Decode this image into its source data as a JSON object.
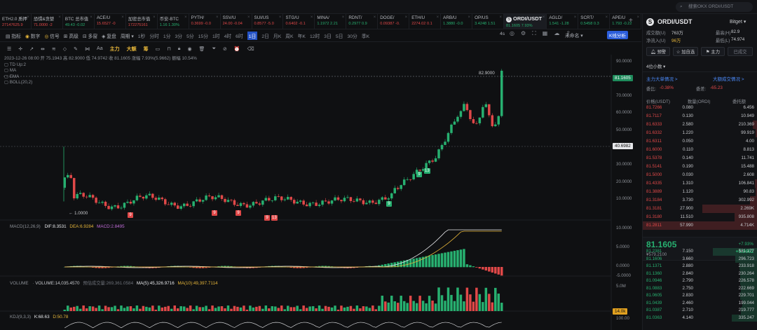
{
  "search": {
    "placeholder": "搜索OKX ORDI/USDT"
  },
  "tickers": [
    {
      "name": "ETH2.0 质押",
      "price": "27147625.9",
      "dir": "dn"
    },
    {
      "name": "恐惧&贪婪",
      "price": "71.0000 -2",
      "dir": "dn"
    },
    {
      "name": "BTC 总市值",
      "price": "49.43 -0.02",
      "dir": "up"
    },
    {
      "name": "ACE/U",
      "price": "15.6527 -0",
      "dir": "dn"
    },
    {
      "name": "加密总市值",
      "price": "172275161",
      "dir": "dn"
    },
    {
      "name": "币安-BTC",
      "price": "1.16 1.30%",
      "dir": "up"
    },
    {
      "name": "PYTH/",
      "price": "0.3699 -0.0",
      "dir": "dn"
    },
    {
      "name": "SSV/U",
      "price": "24.00 -0.04",
      "dir": "dn"
    },
    {
      "name": "SUI/US",
      "price": "0.8577 -5.0",
      "dir": "dn"
    },
    {
      "name": "STG/U",
      "price": "0.6402 -0.1",
      "dir": "dn"
    },
    {
      "name": "MINA/",
      "price": "1.1972 2.21",
      "dir": "up"
    },
    {
      "name": "RDNT/",
      "price": "0.2977 0.9",
      "dir": "up"
    },
    {
      "name": "DOGE/",
      "price": "0.09387 -0.",
      "dir": "dn"
    },
    {
      "name": "ETH/U",
      "price": "2274.02 0.1",
      "dir": "dn"
    },
    {
      "name": "ARB/U",
      "price": "1.3880 -0.0",
      "dir": "up"
    },
    {
      "name": "OP/US",
      "price": "3.4248 1.51",
      "dir": "up"
    },
    {
      "name": "ORDI/USDT",
      "price": "81.1605 7.93%",
      "dir": "up",
      "active": true
    },
    {
      "name": "AGLD/",
      "price": "1.541 -1.28",
      "dir": "up"
    },
    {
      "name": "SCRT/",
      "price": "0.5458 0.3",
      "dir": "up"
    },
    {
      "name": "APE/U",
      "price": "1.793 -0.22",
      "dir": "up"
    }
  ],
  "toolbar1": {
    "items": [
      "指标",
      "数字",
      "信号",
      "高级",
      "多窗",
      "复盘",
      "周期"
    ],
    "timeframes": [
      "1秒",
      "分时",
      "1分",
      "3分",
      "5分",
      "15分",
      "1时",
      "4时",
      "6时",
      "1日",
      "2日",
      "月K",
      "周K",
      "年K",
      "12时",
      "3日",
      "5日",
      "30分",
      "季K"
    ],
    "selected_tf": "1日",
    "right_time": "4s",
    "layout_name": "未命名",
    "kline_btn": "K线分析"
  },
  "toolbar2": {
    "labels": [
      "主力",
      "大额",
      "筹"
    ]
  },
  "chart": {
    "info": "2023-12-26 08:00  开 75.1943  高 82.9000  低 74.9742  收 81.1605  涨幅 7.93%(5.9662)  振幅 10.54%",
    "indicators": [
      "TD  Up:2",
      "MA",
      "EMA",
      "BOLL(20,2)"
    ],
    "high_label": "82.9000",
    "low_label": "1.0000",
    "current_price": "81.1605",
    "cross_price": "40.6982",
    "price_ticks": [
      "90.0000",
      "70.0000",
      "60.0000",
      "50.0000",
      "30.0000",
      "20.0000",
      "10.0000"
    ],
    "macd_label": "MACD(12,26,9)",
    "macd_dif": "DIF:8.3531",
    "macd_dea": "DEA:6.9284",
    "macd_val": "MACD:2.8495",
    "macd_ticks": [
      "10.0000",
      "5.0000",
      "0.0000",
      "-5.0000"
    ],
    "vol_label": "VOLUME",
    "vol_val": "VOLUME:14,035.4570",
    "vol_est": "预估成交量:269,361.0584",
    "vol_ma5": "MA(5):45,326.9716",
    "vol_ma10": "MA(10):49,397.7114",
    "vol_ticks": [
      "5.0M"
    ],
    "vol_tag": "14.0k",
    "kdj_label": "KDJ(9,3,3)",
    "kdj_k": "K:68.63",
    "kdj_d": "D:50.78",
    "kdj_tick": "100.00",
    "td_marks": [
      "9",
      "9",
      "9",
      "9",
      "13",
      "9",
      "9",
      "13"
    ]
  },
  "right_panel": {
    "symbol": "ORDI/USDT",
    "exchange": "Bitget",
    "vol_label": "成交额(U)",
    "vol_value": "763万",
    "high_label": "最高(H)",
    "high_value": "82.9",
    "inflow_label": "净流入(U)",
    "inflow_value": "96万",
    "low_label": "最低(L)",
    "low_value": "74.974",
    "buttons": [
      "预警",
      "加自选",
      "主力",
      "已成交"
    ],
    "decimals": "4位小数",
    "big_order": "主力大单情况 >",
    "big_trade": "大额成交情况 >",
    "ratio_label": "委比:",
    "ratio_value": "-0.38%",
    "diff_label": "委差:",
    "diff_value": "-65.23",
    "headers": [
      "价格(USDT)",
      "数量(ORDI)",
      "委托额"
    ],
    "asks": [
      [
        "81.7266",
        "0.080",
        "6.456"
      ],
      [
        "81.7117",
        "0.130",
        "10.949"
      ],
      [
        "81.6333",
        "2.580",
        "210.369"
      ],
      [
        "81.6332",
        "1.220",
        "99.919"
      ],
      [
        "81.6311",
        "0.050",
        "4.00"
      ],
      [
        "81.6000",
        "0.110",
        "8.813"
      ],
      [
        "81.5378",
        "0.140",
        "11.741"
      ],
      [
        "81.5141",
        "0.190",
        "15.488"
      ],
      [
        "81.5000",
        "0.030",
        "2.608"
      ],
      [
        "81.4335",
        "1.310",
        "106.841"
      ],
      [
        "81.3889",
        "1.120",
        "90.83"
      ],
      [
        "81.3184",
        "3.730",
        "302.992"
      ],
      [
        "81.3181",
        "27.900",
        "2.269K"
      ],
      [
        "81.3180",
        "11.510",
        "935.808"
      ],
      [
        "81.2811",
        "57.990",
        "4.714K"
      ]
    ],
    "last_price": "81.1605",
    "last_cny": "¥579.2100",
    "change_pct": "+7.93%",
    "change_abs": "+5.9662",
    "bids": [
      [
        "81.2381",
        "7.150",
        "581.177"
      ],
      [
        "81.1606",
        "3.660",
        "296.723"
      ],
      [
        "81.1371",
        "2.880",
        "233.918"
      ],
      [
        "81.1360",
        "2.840",
        "230.264"
      ],
      [
        "81.0946",
        "2.790",
        "226.578"
      ],
      [
        "81.0883",
        "2.750",
        "222.669"
      ],
      [
        "81.0605",
        "2.830",
        "229.701"
      ],
      [
        "81.0439",
        "2.460",
        "199.044"
      ],
      [
        "81.0387",
        "2.710",
        "219.777"
      ],
      [
        "81.0363",
        "4.140",
        "335.247"
      ]
    ]
  },
  "colors": {
    "up": "#27b070",
    "down": "#e04848",
    "accent": "#2b5ddb",
    "yellow": "#e8b73a"
  }
}
